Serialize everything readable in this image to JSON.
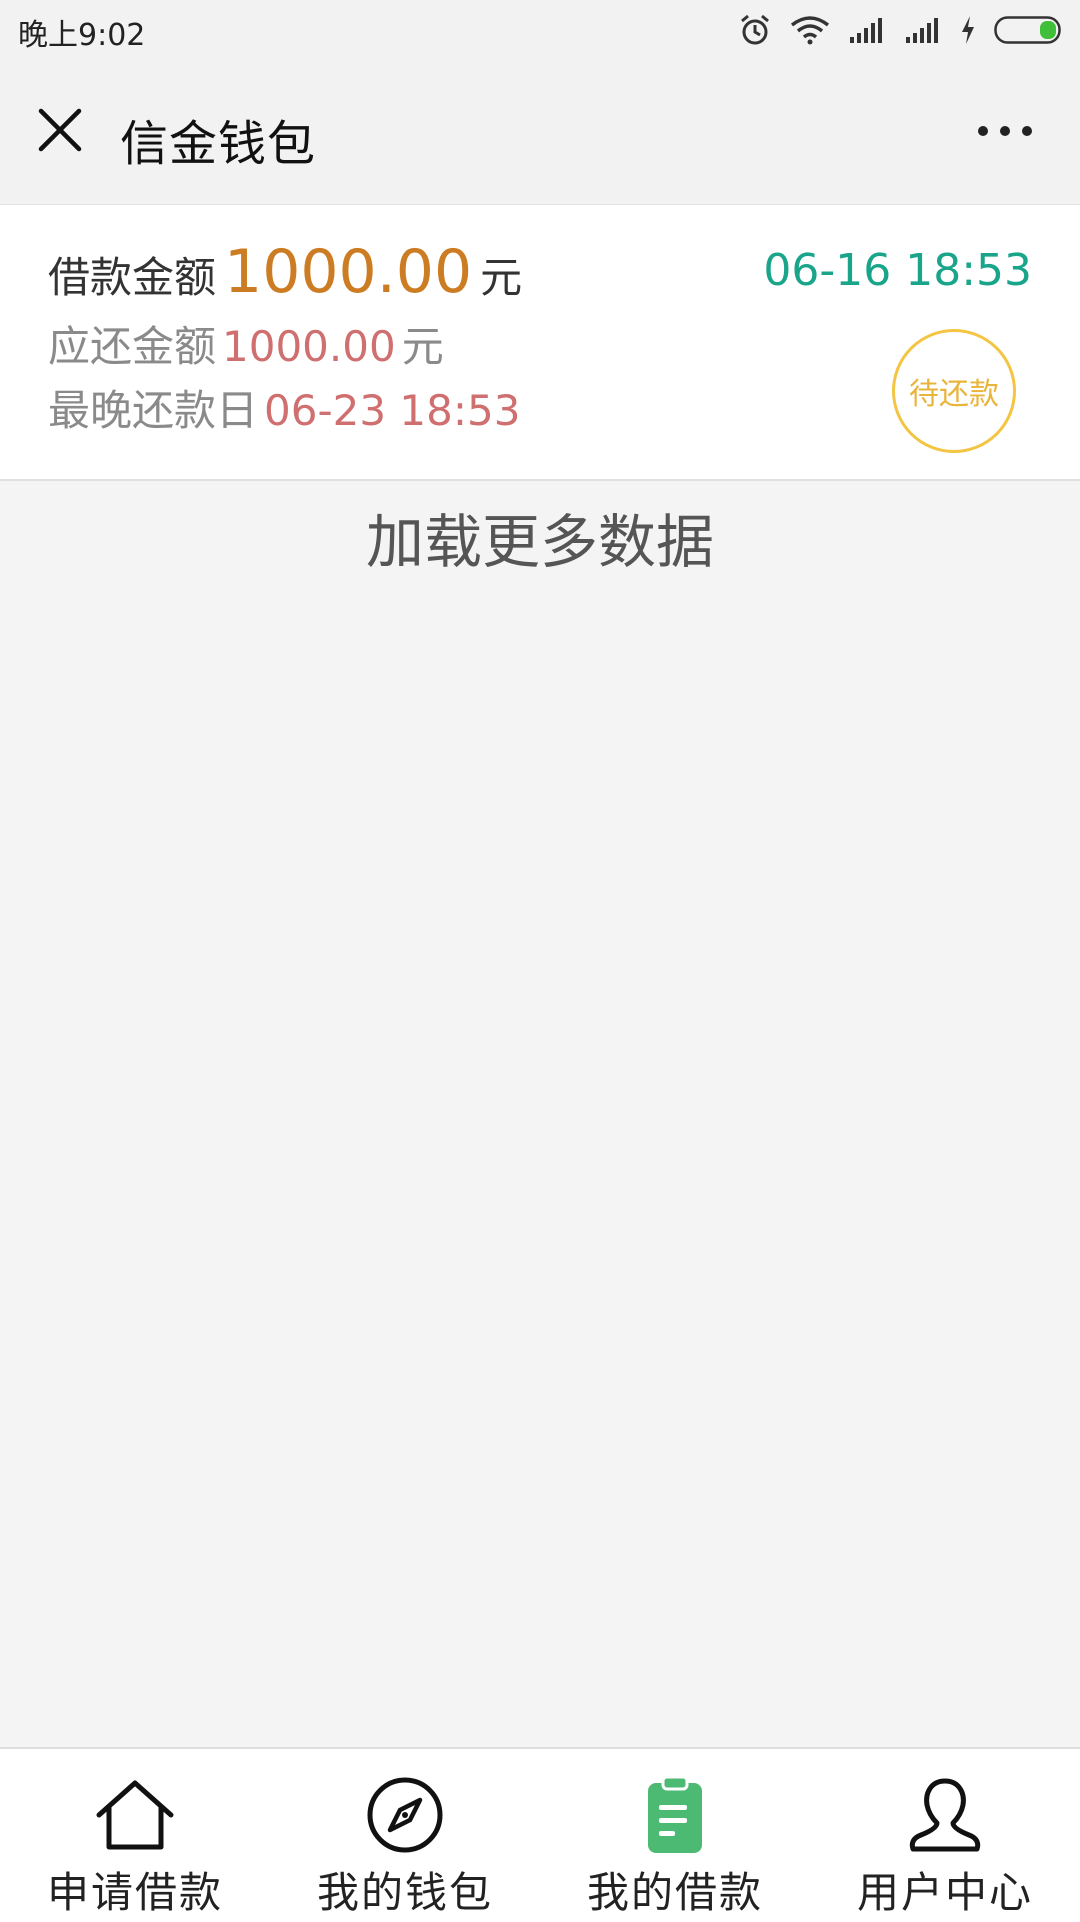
{
  "status_bar": {
    "time": "晚上9:02",
    "icons": [
      "alarm-icon",
      "wifi-icon",
      "signal-icon",
      "signal-icon",
      "charging-icon",
      "battery-icon"
    ]
  },
  "header": {
    "title": "信金钱包",
    "close_icon": "close-icon",
    "more_icon": "more-icon"
  },
  "loan": {
    "amount_label": "借款金额",
    "amount": "1000.00",
    "amount_unit": "元",
    "date": "06-16 18:53",
    "due_label": "应还金额",
    "due_amount": "1000.00",
    "due_unit": "元",
    "deadline_label": "最晚还款日",
    "deadline": "06-23 18:53",
    "status": "待还款"
  },
  "load_more": "加载更多数据",
  "tabs": [
    {
      "label": "申请借款",
      "icon": "home-icon",
      "active": false
    },
    {
      "label": "我的钱包",
      "icon": "compass-icon",
      "active": false
    },
    {
      "label": "我的借款",
      "icon": "clipboard-icon",
      "active": true
    },
    {
      "label": "用户中心",
      "icon": "user-icon",
      "active": false
    }
  ],
  "colors": {
    "amount": "#cc7c22",
    "due": "#cf6f6f",
    "date": "#1aa58b",
    "badge": "#f4c542",
    "active_tab": "#4cba72"
  }
}
